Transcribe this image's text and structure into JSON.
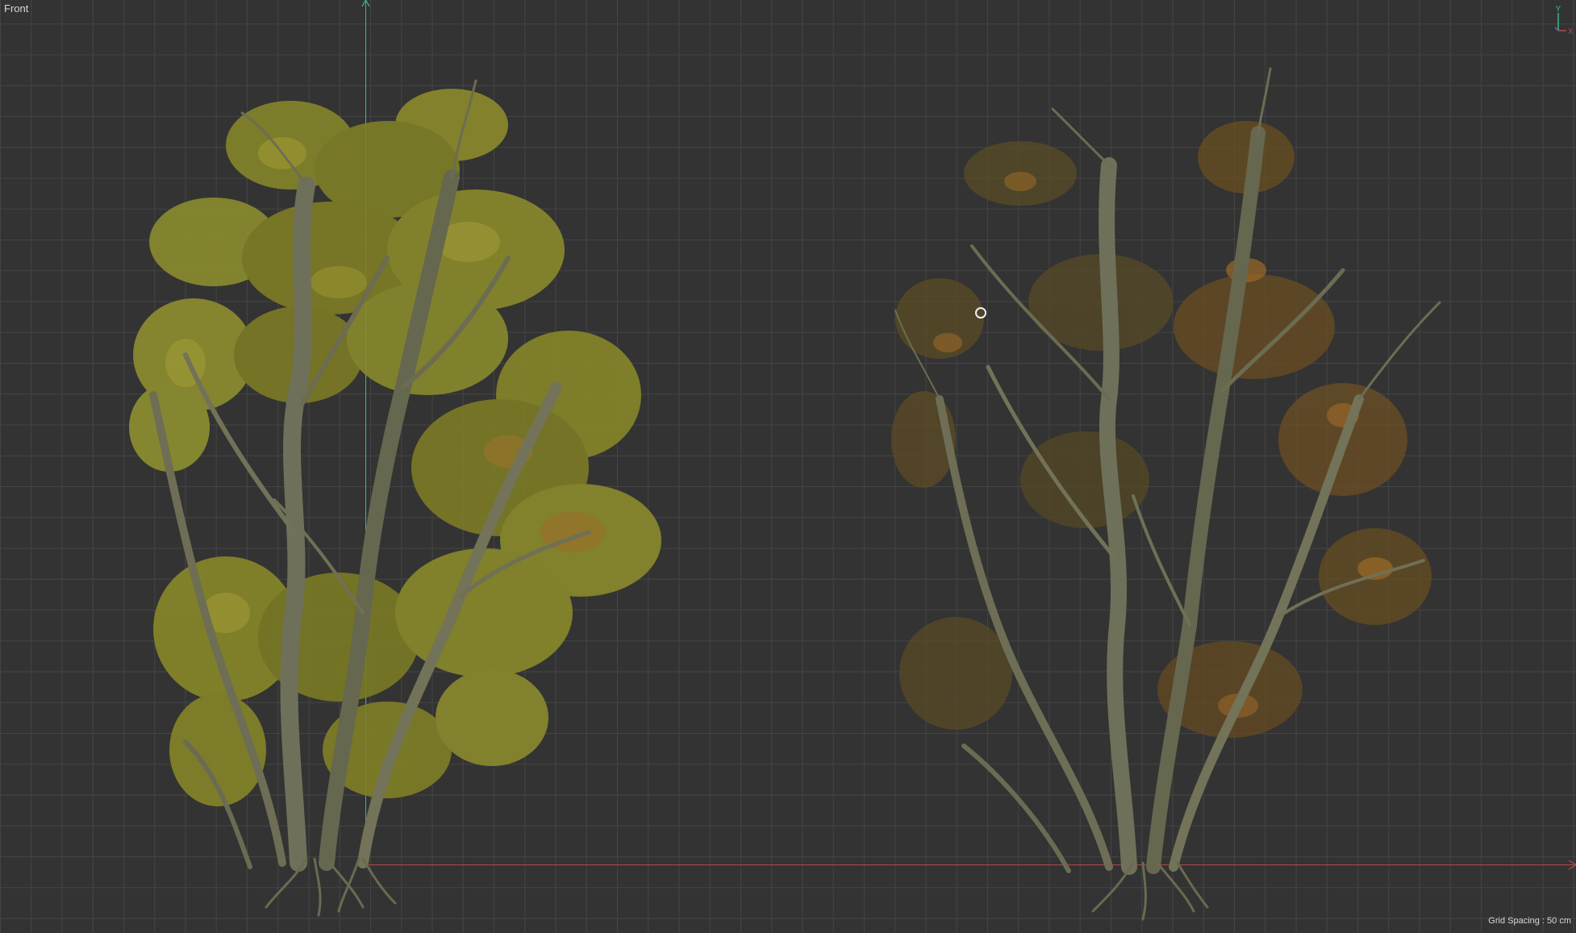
{
  "viewport": {
    "label": "Front",
    "grid_spacing": "Grid Spacing : 50 cm"
  },
  "gizmo": {
    "y_label": "Y",
    "x_label": "X",
    "z_label": "Z"
  },
  "colors": {
    "background": "#333333",
    "grid_line": "#444444",
    "y_axis": "#3fb884",
    "x_axis": "#b64848",
    "foliage_full": "#8d8a2a",
    "foliage_sparse": "#7a5624",
    "bark": "#6f705a"
  },
  "objects": [
    {
      "name": "tree-full-foliage",
      "icon": "tree-icon"
    },
    {
      "name": "tree-sparse-foliage",
      "icon": "tree-icon"
    }
  ]
}
